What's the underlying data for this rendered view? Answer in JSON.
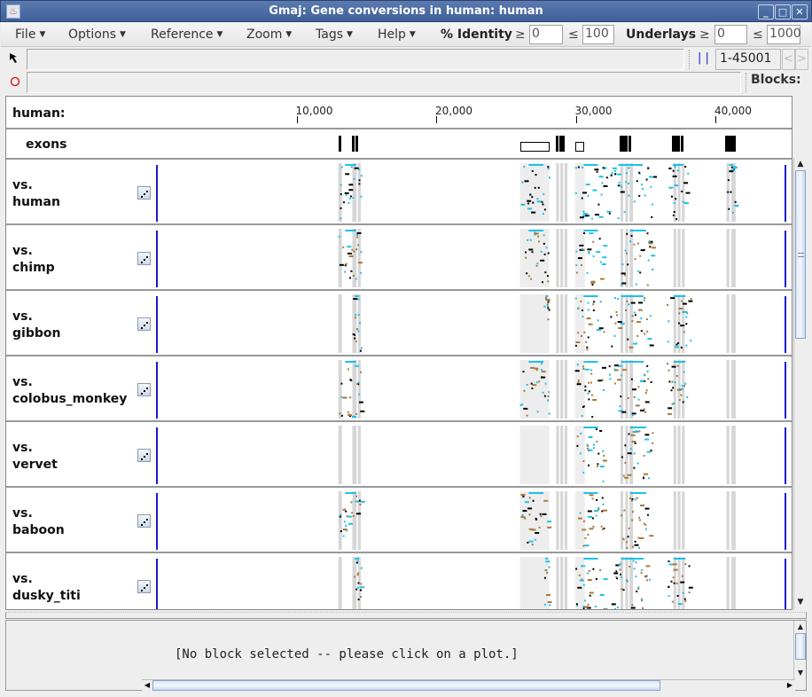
{
  "window": {
    "title": "Gmaj: Gene conversions in human: human",
    "buttons": {
      "minimize": "_",
      "maximize": "□",
      "close": "✕"
    }
  },
  "menubar": {
    "menus": [
      {
        "label": "File"
      },
      {
        "label": "Options"
      },
      {
        "label": "Reference"
      },
      {
        "label": "Zoom"
      },
      {
        "label": "Tags"
      },
      {
        "label": "Help"
      }
    ],
    "identity": {
      "label": "% Identity",
      "ge_symbol": "≥",
      "min_value": "0",
      "le_symbol": "≤",
      "max_value": "100"
    },
    "underlays": {
      "label": "Underlays",
      "ge_symbol": "≥",
      "min_value": "0",
      "le_symbol": "≤",
      "max_value": "1000"
    }
  },
  "toolbar": {
    "pointer_icon": "arrow-pointer-icon",
    "mark_icon": "red-circle-icon",
    "range_marker": "| |",
    "range_value": "1-45001",
    "prev_label": "<",
    "next_label": ">",
    "blocks_label": "Blocks:"
  },
  "reference": {
    "label": "human:",
    "sequence_length": 45001,
    "ruler_ticks": [
      {
        "position": 10000,
        "label": "10,000"
      },
      {
        "position": 20000,
        "label": "20,000"
      },
      {
        "position": 30000,
        "label": "30,000"
      },
      {
        "position": 40000,
        "label": "40,000"
      }
    ]
  },
  "exons": {
    "label": "exons",
    "features": [
      {
        "type": "exon",
        "start": 13000,
        "end": 13150
      },
      {
        "type": "exon",
        "start": 13950,
        "end": 14100
      },
      {
        "type": "exon",
        "start": 14250,
        "end": 14400
      },
      {
        "type": "box",
        "start": 26000,
        "end": 28100
      },
      {
        "type": "exon",
        "start": 28600,
        "end": 28720
      },
      {
        "type": "exon",
        "start": 28800,
        "end": 28920
      },
      {
        "type": "exon",
        "start": 29000,
        "end": 29120
      },
      {
        "type": "box",
        "start": 29950,
        "end": 30600
      },
      {
        "type": "exon",
        "start": 33150,
        "end": 33270
      },
      {
        "type": "exon",
        "start": 33350,
        "end": 33470
      },
      {
        "type": "exon",
        "start": 33550,
        "end": 33670
      },
      {
        "type": "exon",
        "start": 33750,
        "end": 33870
      },
      {
        "type": "exon",
        "start": 36900,
        "end": 37020
      },
      {
        "type": "exon",
        "start": 37100,
        "end": 37220
      },
      {
        "type": "exon",
        "start": 37300,
        "end": 37420
      },
      {
        "type": "exon",
        "start": 37500,
        "end": 37620
      },
      {
        "type": "exon",
        "start": 40700,
        "end": 40820
      },
      {
        "type": "exon",
        "start": 40900,
        "end": 41020
      },
      {
        "type": "exon",
        "start": 41100,
        "end": 41220
      },
      {
        "type": "exon",
        "start": 41300,
        "end": 41420
      }
    ]
  },
  "underlay_regions": [
    {
      "start": 13000,
      "end": 13250,
      "shade": "#d6d6d6"
    },
    {
      "start": 14000,
      "end": 14300,
      "shade": "#d6d6d6"
    },
    {
      "start": 14400,
      "end": 14600,
      "shade": "#d6d6d6"
    },
    {
      "start": 26000,
      "end": 28100,
      "shade": "#ededed"
    },
    {
      "start": 28600,
      "end": 28800,
      "shade": "#d6d6d6"
    },
    {
      "start": 28900,
      "end": 29100,
      "shade": "#d6d6d6"
    },
    {
      "start": 29200,
      "end": 29400,
      "shade": "#d6d6d6"
    },
    {
      "start": 29950,
      "end": 30650,
      "shade": "#ededed"
    },
    {
      "start": 33200,
      "end": 33400,
      "shade": "#d6d6d6"
    },
    {
      "start": 33550,
      "end": 33750,
      "shade": "#d6d6d6"
    },
    {
      "start": 33850,
      "end": 34100,
      "shade": "#d6d6d6"
    },
    {
      "start": 37000,
      "end": 37200,
      "shade": "#d6d6d6"
    },
    {
      "start": 37300,
      "end": 37500,
      "shade": "#d6d6d6"
    },
    {
      "start": 37600,
      "end": 37800,
      "shade": "#d6d6d6"
    },
    {
      "start": 40800,
      "end": 41000,
      "shade": "#d6d6d6"
    },
    {
      "start": 41150,
      "end": 41450,
      "shade": "#d6d6d6"
    }
  ],
  "colors": {
    "cyan_dots": "#1fc0e8",
    "brown_dots": "#a8793a",
    "black_dots": "#000000",
    "axis_line": "#1a1acc"
  },
  "comparisons": [
    {
      "prefix": "vs.",
      "species": "human",
      "dot_button": "dotplot-icon",
      "clusters": [
        [
          13000,
          14600
        ],
        [
          26000,
          28100
        ],
        [
          29950,
          32000
        ],
        [
          32000,
          35500
        ],
        [
          36500,
          38000
        ],
        [
          40800,
          41400
        ]
      ],
      "has_brown": false
    },
    {
      "prefix": "vs.",
      "species": "chimp",
      "dot_button": "dotplot-icon",
      "clusters": [
        [
          13000,
          14600
        ],
        [
          26000,
          28100
        ],
        [
          29950,
          32000
        ],
        [
          33200,
          35500
        ]
      ],
      "has_brown": true
    },
    {
      "prefix": "vs.",
      "species": "gibbon",
      "dot_button": "dotplot-icon",
      "clusters": [
        [
          14000,
          14600
        ],
        [
          27700,
          28100
        ],
        [
          29950,
          32000
        ],
        [
          32300,
          35500
        ],
        [
          36500,
          38200
        ]
      ],
      "has_brown": true
    },
    {
      "prefix": "vs.",
      "species": "colobus_monkey",
      "dot_button": "dotplot-icon",
      "clusters": [
        [
          13000,
          14600
        ],
        [
          26000,
          28100
        ],
        [
          29950,
          32000
        ],
        [
          32300,
          35500
        ],
        [
          36500,
          38200
        ]
      ],
      "has_brown": true
    },
    {
      "prefix": "vs.",
      "species": "vervet",
      "dot_button": "dotplot-icon",
      "clusters": [
        [
          29950,
          32000
        ],
        [
          33200,
          35500
        ]
      ],
      "has_brown": true
    },
    {
      "prefix": "vs.",
      "species": "baboon",
      "dot_button": "dotplot-icon",
      "clusters": [
        [
          13000,
          14600
        ],
        [
          26000,
          28100
        ],
        [
          29950,
          32000
        ],
        [
          33200,
          35500
        ]
      ],
      "has_brown": true
    },
    {
      "prefix": "vs.",
      "species": "dusky_titi",
      "dot_button": "dotplot-icon",
      "clusters": [
        [
          14000,
          14600
        ],
        [
          27700,
          28100
        ],
        [
          29950,
          32000
        ],
        [
          32300,
          35500
        ],
        [
          36500,
          38200
        ]
      ],
      "has_brown": true
    }
  ],
  "text_panel": {
    "message": "[No block selected -- please click on a plot.]"
  }
}
